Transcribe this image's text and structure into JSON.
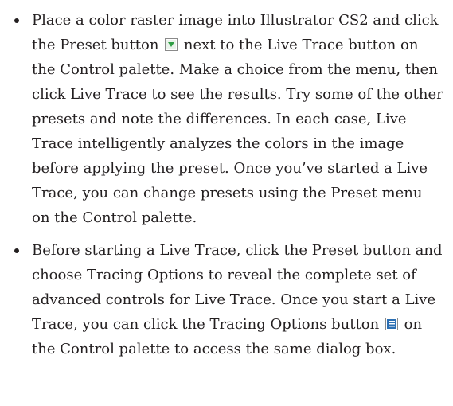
{
  "bullets": [
    {
      "segments": [
        "Place a color raster image into Illustrator CS2 and click the Preset button",
        "next to the Live Trace button on the Control palette. Make a choice from the menu, then click Live Trace to see the results. Try some of the other presets and note the differences. In each case, Live Trace intelligently analyzes the colors in the image before applying the preset. Once you’ve started a Live Trace, you can change presets using the Preset menu on the Control palette."
      ],
      "icon": "preset-triangle-icon"
    },
    {
      "segments": [
        "Before starting a Live Trace, click the Preset button and choose Tracing Options to reveal the complete set of advanced controls for Live Trace. Once you start a Live Trace, you can click the Tracing Options button",
        "on the Control palette to access the same dialog box."
      ],
      "icon": "tracing-options-icon"
    }
  ],
  "colors": {
    "text": "#231f20",
    "preset_icon_fill": "#2f9e44",
    "tracing_icon_fill": "#2c6fb3"
  }
}
